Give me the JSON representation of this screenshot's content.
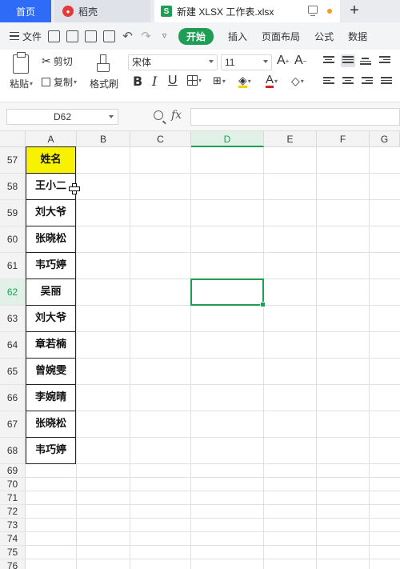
{
  "tabs": {
    "home": "首页",
    "docer": "稻壳",
    "file": "新建 XLSX 工作表.xlsx",
    "sheet_logo": "S"
  },
  "menu": {
    "file": "文件",
    "start": "开始",
    "items": [
      "插入",
      "页面布局",
      "公式",
      "数据"
    ]
  },
  "ribbon": {
    "paste": "粘贴",
    "cut": "剪切",
    "copy": "复制",
    "format_painter": "格式刷",
    "font": "宋体",
    "size": "11",
    "grow": "A",
    "shrink": "A"
  },
  "formula_bar": {
    "cell_ref": "D62",
    "fx": "fx",
    "formula": ""
  },
  "grid": {
    "columns": [
      "A",
      "B",
      "C",
      "D",
      "E",
      "F",
      "G"
    ],
    "selected_column": "D",
    "rows": [
      "57",
      "58",
      "59",
      "60",
      "61",
      "62",
      "63",
      "64",
      "65",
      "66",
      "67",
      "68",
      "69",
      "70",
      "71",
      "72",
      "73",
      "74",
      "75",
      "76"
    ],
    "selected_row": "62",
    "columnA": [
      "姓名",
      "王小二",
      "刘大爷",
      "张晓松",
      "韦巧婷",
      "吴丽",
      "刘大爷",
      "章若楠",
      "曾婉雯",
      "李婉晴",
      "张晓松",
      "韦巧婷"
    ]
  },
  "colors": {
    "accent": "#1f9d55",
    "header_fill": "#f7f300",
    "home_tab": "#2e6bf6"
  }
}
